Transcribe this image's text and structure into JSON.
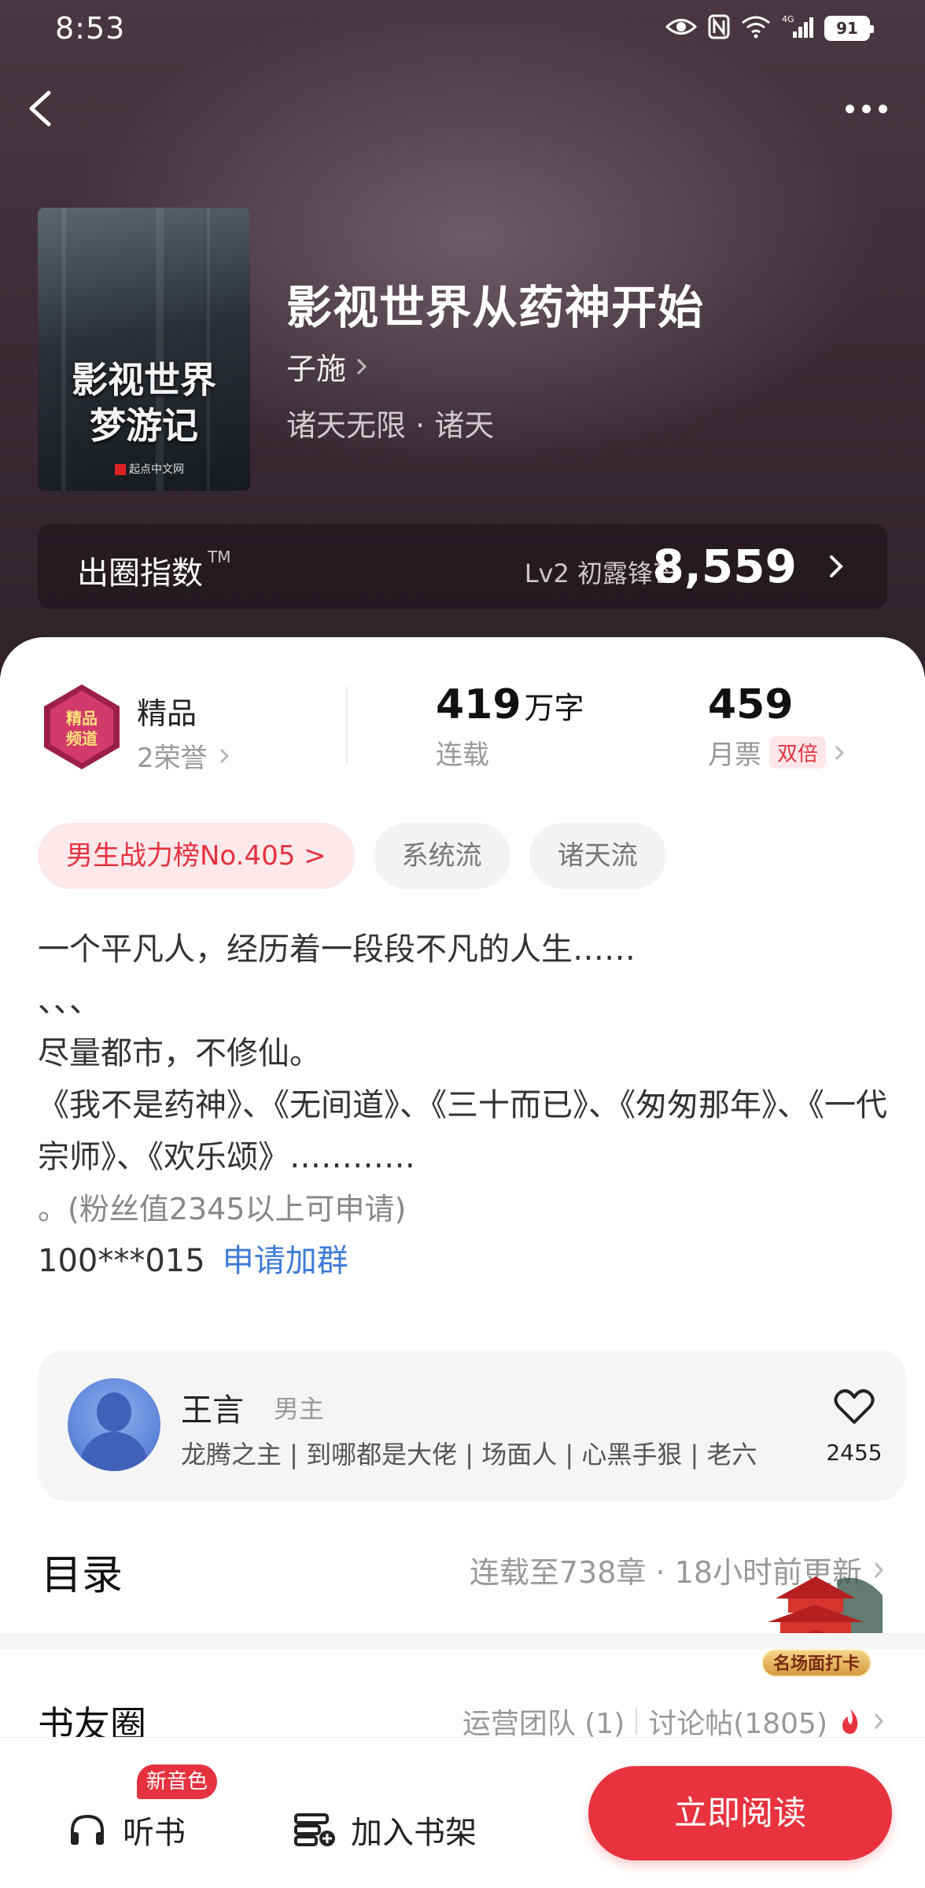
{
  "status_bar": {
    "time": "8:53",
    "battery": "91",
    "network": "4G"
  },
  "book": {
    "cover_text": "影视世界梦游记",
    "cover_publisher": "起点中文网",
    "title": "影视世界从药神开始",
    "author": "子施",
    "genre": "诸天无限 · 诸天"
  },
  "fan_index": {
    "label": "出圈指数",
    "tm": "TM",
    "level": "Lv2 初露锋芒",
    "score": "8,559"
  },
  "honor": {
    "badge_text": "精品频道",
    "label": "精品",
    "count": "2荣誉"
  },
  "stats": {
    "words": {
      "value": "419",
      "unit": "万字",
      "label": "连载"
    },
    "tickets": {
      "value": "459",
      "label": "月票",
      "badge": "双倍"
    }
  },
  "tags": [
    "男生战力榜No.405 >",
    "系统流",
    "诸天流"
  ],
  "intro": {
    "line1": "一个平凡人，经历着一段段不凡的人生……",
    "line2": "、、、",
    "line3": "尽量都市，不修仙。",
    "line4": "《我不是药神》、《无间道》、《三十而已》、《匆匆那年》、《一代宗师》、《欢乐颂》…………",
    "line5": "。(粉丝值2345以上可申请)",
    "group_id": "100***015",
    "join_link": "申请加群"
  },
  "character": {
    "name": "王言",
    "role": "男主",
    "desc": "龙腾之主 | 到哪都是大佬 | 场面人 | 心黑手狠 | 老六",
    "likes": "2455"
  },
  "toc": {
    "label": "目录",
    "meta": "连载至738章 · 18小时前更新"
  },
  "checkin": {
    "label": "名场面打卡"
  },
  "circle": {
    "label": "书友圈",
    "team": "运营团队 (1)",
    "posts": "讨论帖(1805)"
  },
  "bottom": {
    "listen": "听书",
    "listen_badge": "新音色",
    "shelf": "加入书架",
    "read": "立即阅读"
  },
  "colors": {
    "accent": "#e8333f",
    "link": "#3d7bd8",
    "hero_bg": "#3d2d36"
  }
}
